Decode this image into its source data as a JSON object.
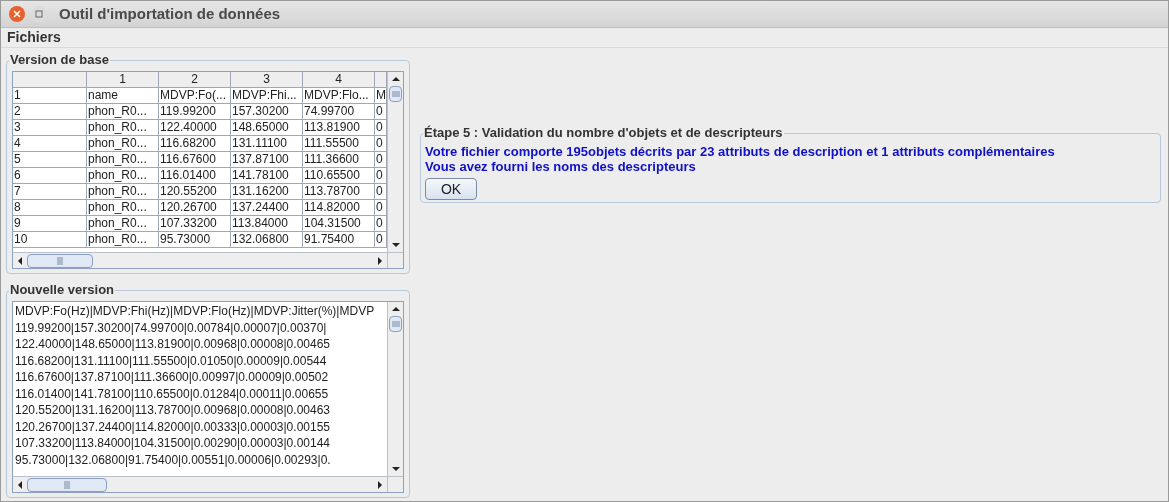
{
  "window": {
    "title": "Outil d'importation de données"
  },
  "menu": [
    "Fichiers"
  ],
  "base_version": {
    "title": "Version de base",
    "columns": [
      "",
      "1",
      "2",
      "3",
      "4"
    ],
    "rows": [
      [
        "1",
        "name",
        "MDVP:Fo(...",
        "MDVP:Fhi...",
        "MDVP:Flo...",
        "M"
      ],
      [
        "2",
        "phon_R0...",
        "119.99200",
        "157.30200",
        "74.99700",
        "0"
      ],
      [
        "3",
        "phon_R0...",
        "122.40000",
        "148.65000",
        "113.81900",
        "0"
      ],
      [
        "4",
        "phon_R0...",
        "116.68200",
        "131.11100",
        "111.55500",
        "0"
      ],
      [
        "5",
        "phon_R0...",
        "116.67600",
        "137.87100",
        "111.36600",
        "0"
      ],
      [
        "6",
        "phon_R0...",
        "116.01400",
        "141.78100",
        "110.65500",
        "0"
      ],
      [
        "7",
        "phon_R0...",
        "120.55200",
        "131.16200",
        "113.78700",
        "0"
      ],
      [
        "8",
        "phon_R0...",
        "120.26700",
        "137.24400",
        "114.82000",
        "0"
      ],
      [
        "9",
        "phon_R0...",
        "107.33200",
        "113.84000",
        "104.31500",
        "0"
      ],
      [
        "10",
        "phon_R0...",
        "95.73000",
        "132.06800",
        "91.75400",
        "0"
      ]
    ]
  },
  "new_version": {
    "title": "Nouvelle version",
    "lines": [
      "MDVP:Fo(Hz)|MDVP:Fhi(Hz)|MDVP:Flo(Hz)|MDVP:Jitter(%)|MDVP",
      "119.99200|157.30200|74.99700|0.00784|0.00007|0.00370|",
      "122.40000|148.65000|113.81900|0.00968|0.00008|0.00465",
      "116.68200|131.11100|111.55500|0.01050|0.00009|0.00544",
      "116.67600|137.87100|111.36600|0.00997|0.00009|0.00502",
      "116.01400|141.78100|110.65500|0.01284|0.00011|0.00655",
      "120.55200|131.16200|113.78700|0.00968|0.00008|0.00463",
      "120.26700|137.24400|114.82000|0.00333|0.00003|0.00155",
      "107.33200|113.84000|104.31500|0.00290|0.00003|0.00144",
      "95.73000|132.06800|91.75400|0.00551|0.00006|0.00293|0."
    ]
  },
  "step": {
    "title": "Étape 5 : Validation du nombre d'objets et de descripteurs",
    "messages": [
      "Votre fichier comporte 195objets décrits par  23 attributs de description et  1 attributs complémentaires",
      "Vous avez fourni les noms des descripteurs"
    ],
    "button": "OK"
  }
}
